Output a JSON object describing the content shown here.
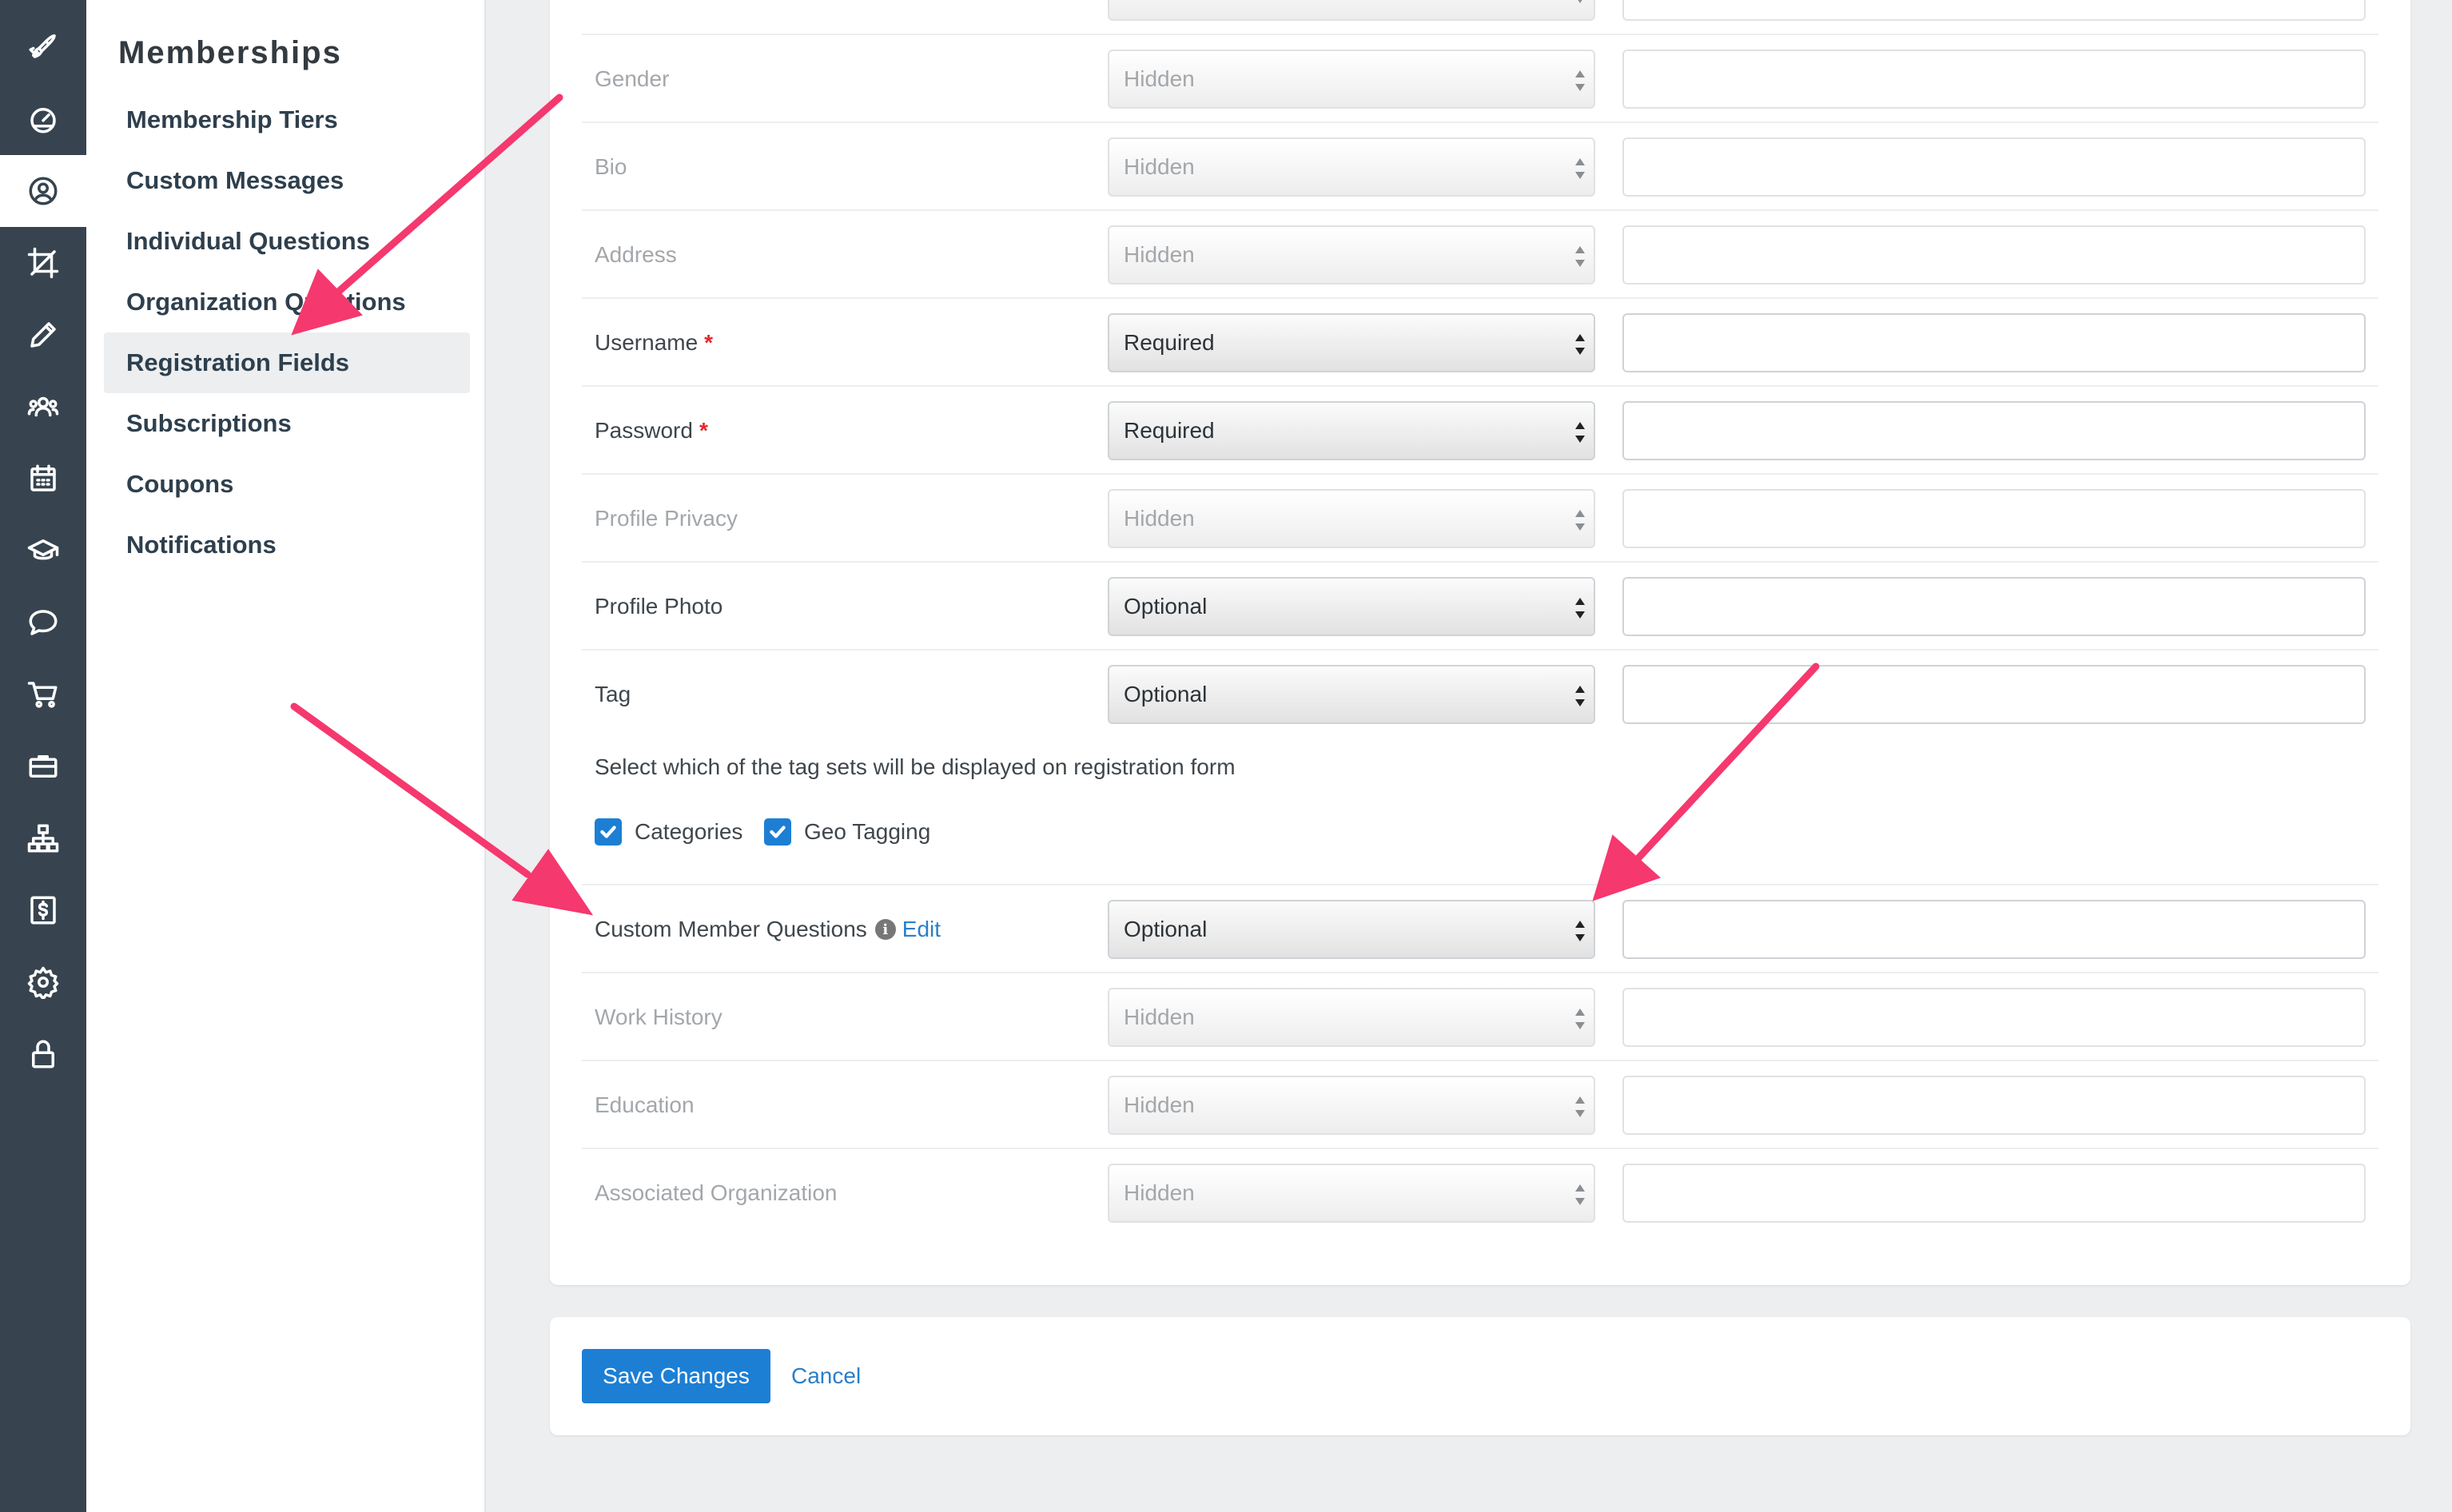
{
  "rail": {
    "items": [
      {
        "icon": "rocket-icon"
      },
      {
        "icon": "dashboard-gauge-icon"
      },
      {
        "icon": "user-circle-icon",
        "active": true
      },
      {
        "icon": "crop-icon"
      },
      {
        "icon": "pencil-icon"
      },
      {
        "icon": "users-group-icon"
      },
      {
        "icon": "calendar-icon"
      },
      {
        "icon": "graduation-cap-icon"
      },
      {
        "icon": "chat-bubble-icon"
      },
      {
        "icon": "shopping-cart-icon"
      },
      {
        "icon": "briefcase-icon"
      },
      {
        "icon": "sitemap-icon"
      },
      {
        "icon": "dollar-icon"
      },
      {
        "icon": "gear-icon"
      },
      {
        "icon": "lock-icon"
      }
    ]
  },
  "subnav": {
    "title": "Memberships",
    "items": [
      {
        "label": "Membership Tiers"
      },
      {
        "label": "Custom Messages"
      },
      {
        "label": "Individual Questions"
      },
      {
        "label": "Organization Questions"
      },
      {
        "label": "Registration Fields",
        "active": true
      },
      {
        "label": "Subscriptions"
      },
      {
        "label": "Coupons"
      },
      {
        "label": "Notifications"
      }
    ]
  },
  "fields": [
    {
      "label": "Gender",
      "value": "Hidden",
      "required_mark": ""
    },
    {
      "label": "Bio",
      "value": "Hidden",
      "required_mark": ""
    },
    {
      "label": "Address",
      "value": "Hidden",
      "required_mark": ""
    },
    {
      "label": "Username",
      "value": "Required",
      "required_mark": "*"
    },
    {
      "label": "Password",
      "value": "Required",
      "required_mark": "*"
    },
    {
      "label": "Profile Privacy",
      "value": "Hidden",
      "required_mark": ""
    },
    {
      "label": "Profile Photo",
      "value": "Optional",
      "required_mark": ""
    },
    {
      "label": "Tag",
      "value": "Optional",
      "required_mark": ""
    }
  ],
  "tag_sets": {
    "label": "Select which of the tag sets will be displayed on registration form",
    "options": [
      {
        "label": "Categories",
        "checked": true
      },
      {
        "label": "Geo Tagging",
        "checked": true
      }
    ]
  },
  "custom_questions": {
    "label": "Custom Member Questions",
    "info_glyph": "i",
    "edit_label": "Edit",
    "value": "Optional"
  },
  "fields_after": [
    {
      "label": "Work History",
      "value": "Hidden"
    },
    {
      "label": "Education",
      "value": "Hidden"
    },
    {
      "label": "Associated Organization",
      "value": "Hidden"
    }
  ],
  "footer": {
    "save_label": "Save Changes",
    "cancel_label": "Cancel"
  },
  "colors": {
    "rail_bg": "#37444f",
    "primary": "#1c7fd4",
    "link": "#2a7fc9",
    "required": "#e5262b",
    "annotation_arrow": "#f5386e"
  }
}
